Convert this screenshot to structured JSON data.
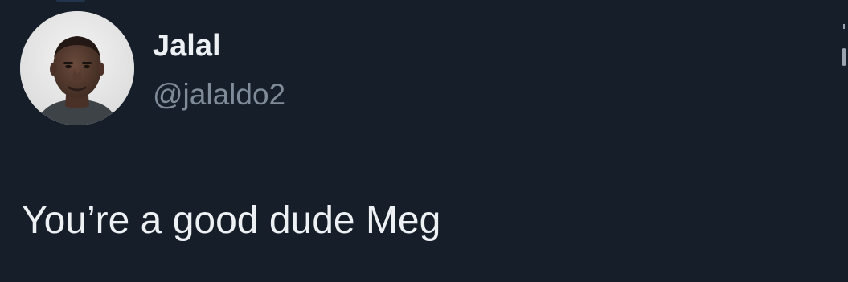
{
  "tweet": {
    "author": {
      "display_name": "Jalal",
      "handle": "@jalaldo2",
      "avatar_icon": "profile-photo"
    },
    "text": "You’re a good dude Meg"
  },
  "ui": {
    "theme": "dark",
    "background_color": "#161e29",
    "primary_text_color": "#eef1f4",
    "secondary_text_color": "#7f8b99"
  }
}
